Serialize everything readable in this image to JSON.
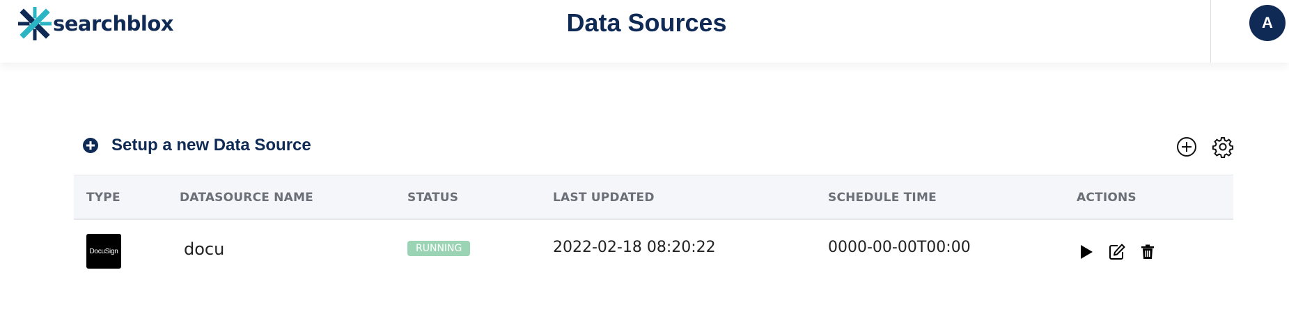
{
  "app": {
    "logo_text": "searchblox",
    "page_title": "Data Sources",
    "avatar_initial": "A"
  },
  "toolbar": {
    "setup_label": "Setup a new Data Source",
    "setup_icon": "plus-circle-filled-icon",
    "add_icon": "plus-circle-icon",
    "settings_icon": "gear-icon"
  },
  "table": {
    "columns": [
      "TYPE",
      "DATASOURCE NAME",
      "STATUS",
      "LAST UPDATED",
      "SCHEDULE TIME",
      "ACTIONS"
    ],
    "rows": [
      {
        "type_logo_text": "DocuSign",
        "name": "docu",
        "status": "RUNNING",
        "last_updated": "2022-02-18 08:20:22",
        "schedule_time": "0000-00-00T00:00",
        "actions": [
          "play-icon",
          "edit-icon",
          "trash-icon"
        ]
      }
    ]
  },
  "colors": {
    "brand_navy": "#0f2a55",
    "logo_teal": "#2bb5c4",
    "status_running": "#9ad4b4",
    "header_bg": "#f5f6f9"
  }
}
